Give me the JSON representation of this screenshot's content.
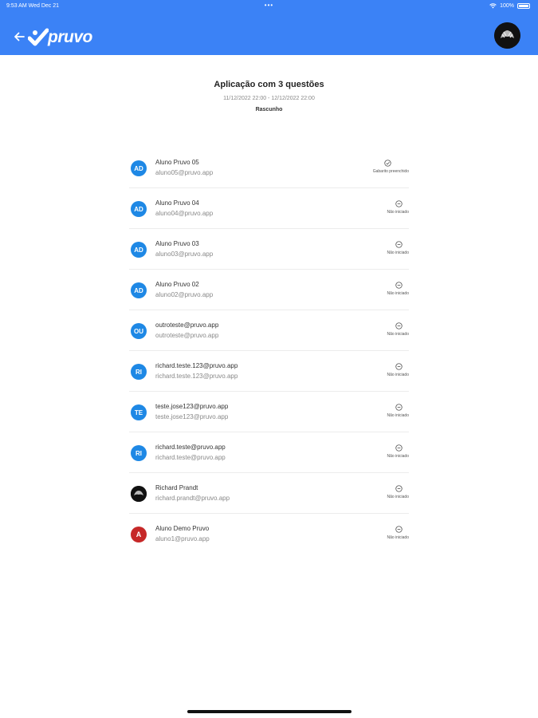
{
  "status_bar": {
    "time": "9:53 AM",
    "date": "Wed Dec 21",
    "dots": "•••",
    "battery": "100%"
  },
  "header": {
    "logo_text": "pruvo",
    "background_color": "#3b82f6"
  },
  "page": {
    "title": "Aplicação com 3 questões",
    "dates": "11/12/2022 22:00 - 12/12/2022 22:00",
    "status": "Rascunho"
  },
  "students": [
    {
      "initials": "AD",
      "name": "Aluno Pruvo 05",
      "email": "aluno05@pruvo.app",
      "status": "Gabarito preenchido",
      "status_icon": "check-circle-icon",
      "avatar": "initials"
    },
    {
      "initials": "AD",
      "name": "Aluno Pruvo 04",
      "email": "aluno04@pruvo.app",
      "status": "Não iniciado",
      "status_icon": "minus-circle-icon",
      "avatar": "initials"
    },
    {
      "initials": "AD",
      "name": "Aluno Pruvo 03",
      "email": "aluno03@pruvo.app",
      "status": "Não iniciado",
      "status_icon": "minus-circle-icon",
      "avatar": "initials"
    },
    {
      "initials": "AD",
      "name": "Aluno Pruvo 02",
      "email": "aluno02@pruvo.app",
      "status": "Não iniciado",
      "status_icon": "minus-circle-icon",
      "avatar": "initials"
    },
    {
      "initials": "OU",
      "name": "outroteste@pruvo.app",
      "email": "outroteste@pruvo.app",
      "status": "Não iniciado",
      "status_icon": "minus-circle-icon",
      "avatar": "initials"
    },
    {
      "initials": "RI",
      "name": "richard.teste.123@pruvo.app",
      "email": "richard.teste.123@pruvo.app",
      "status": "Não iniciado",
      "status_icon": "minus-circle-icon",
      "avatar": "initials"
    },
    {
      "initials": "TE",
      "name": "teste.jose123@pruvo.app",
      "email": "teste.jose123@pruvo.app",
      "status": "Não iniciado",
      "status_icon": "minus-circle-icon",
      "avatar": "initials"
    },
    {
      "initials": "RI",
      "name": "richard.teste@pruvo.app",
      "email": "richard.teste@pruvo.app",
      "status": "Não iniciado",
      "status_icon": "minus-circle-icon",
      "avatar": "initials"
    },
    {
      "initials": "",
      "name": "Richard Prandt",
      "email": "richard.prandt@pruvo.app",
      "status": "Não iniciado",
      "status_icon": "minus-circle-icon",
      "avatar": "photo"
    },
    {
      "initials": "A",
      "name": "Aluno Demo Pruvo",
      "email": "aluno1@pruvo.app",
      "status": "Não iniciado",
      "status_icon": "minus-circle-icon",
      "avatar": "initials-red"
    }
  ]
}
